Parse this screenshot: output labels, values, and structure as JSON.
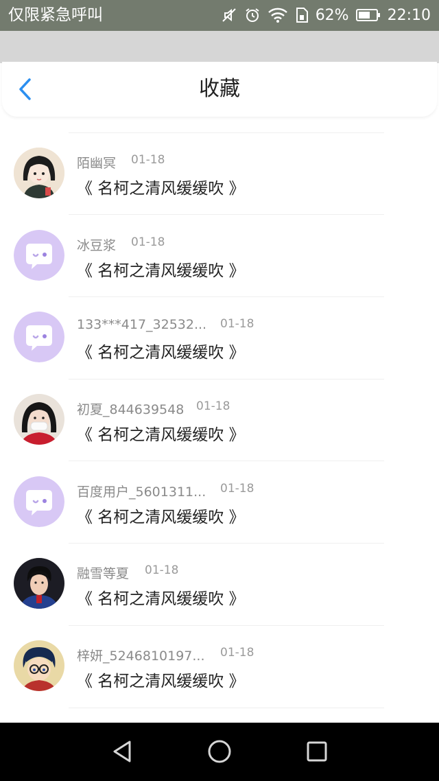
{
  "status_bar": {
    "carrier_text": "仅限紧急呼叫",
    "battery_percent": "62%",
    "time": "22:10",
    "icons": [
      "muted-icon",
      "alarm-icon",
      "wifi-icon",
      "sim-icon",
      "battery-icon"
    ]
  },
  "header": {
    "title": "收藏",
    "back_icon": "chevron-left-icon",
    "accent_color": "#2b8ff0"
  },
  "favorites": [
    {
      "user": "陌幽冥",
      "date": "01-18",
      "content": "《 名柯之清风缓缓吹 》",
      "avatar": "illustrated-girl"
    },
    {
      "user": "冰豆浆",
      "date": "01-18",
      "content": "《 名柯之清风缓缓吹 》",
      "avatar": "default-chat-bubble"
    },
    {
      "user": "133***417_32532...",
      "date": "01-18",
      "content": "《 名柯之清风缓缓吹 》",
      "avatar": "default-chat-bubble"
    },
    {
      "user": "初夏_844639548",
      "date": "01-18",
      "content": "《 名柯之清风缓缓吹 》",
      "avatar": "girl-with-mask"
    },
    {
      "user": "百度用户_5601311...",
      "date": "01-18",
      "content": "《 名柯之清风缓缓吹 》",
      "avatar": "default-chat-bubble"
    },
    {
      "user": "融雪等夏",
      "date": "01-18",
      "content": "《 名柯之清风缓缓吹 》",
      "avatar": "young-man-photo"
    },
    {
      "user": "梓妍_5246810197...",
      "date": "01-18",
      "content": "《 名柯之清风缓缓吹 》",
      "avatar": "anime-boy-glasses"
    }
  ],
  "nav_bar": {
    "icons": [
      "back-triangle-icon",
      "home-circle-icon",
      "recents-square-icon"
    ]
  },
  "colors": {
    "status_bar_bg": "#737b6e",
    "default_avatar_bg": "#d8c8f5",
    "nav_bar_bg": "#000000"
  }
}
